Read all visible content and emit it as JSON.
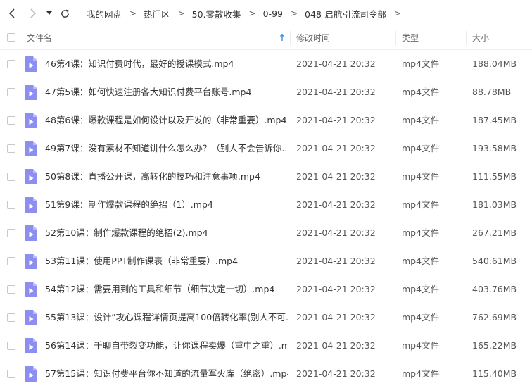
{
  "nav": {
    "breadcrumbs": [
      "我的网盘",
      "热门区",
      "50.零散收集",
      "0-99",
      "048-启航引流司令部"
    ],
    "separator": ">"
  },
  "columns": {
    "name": "文件名",
    "modified": "修改时间",
    "type": "类型",
    "size": "大小"
  },
  "colors": {
    "icon": "#8c8ff0",
    "checkbox_border": "#c8c8c8"
  },
  "files": [
    {
      "name": "46第4课：知识付费时代，最好的授课模式.mp4",
      "modified": "2021-04-21 20:32",
      "type": "mp4文件",
      "size": "188.04MB"
    },
    {
      "name": "47第5课：如何快速注册各大知识付费平台账号.mp4",
      "modified": "2021-04-21 20:32",
      "type": "mp4文件",
      "size": "88.78MB"
    },
    {
      "name": "48第6课：爆款课程是如何设计以及开发的（非常重要）.mp4",
      "modified": "2021-04-21 20:32",
      "type": "mp4文件",
      "size": "187.45MB"
    },
    {
      "name": "49第7课：没有素材不知道讲什么怎么办？（别人不会告诉你...",
      "modified": "2021-04-21 20:32",
      "type": "mp4文件",
      "size": "193.58MB"
    },
    {
      "name": "50第8课：直播公开课，高转化的技巧和注意事项.mp4",
      "modified": "2021-04-21 20:32",
      "type": "mp4文件",
      "size": "111.55MB"
    },
    {
      "name": "51第9课：制作爆款课程的绝招（1）.mp4",
      "modified": "2021-04-21 20:32",
      "type": "mp4文件",
      "size": "181.03MB"
    },
    {
      "name": "52第10课：制作爆款课程的绝招(2).mp4",
      "modified": "2021-04-21 20:32",
      "type": "mp4文件",
      "size": "267.21MB"
    },
    {
      "name": "53第11课：使用PPT制作课表（非常重要）.mp4",
      "modified": "2021-04-21 20:32",
      "type": "mp4文件",
      "size": "540.61MB"
    },
    {
      "name": "54第12课：需要用到的工具和细节（细节决定一切）.mp4",
      "modified": "2021-04-21 20:32",
      "type": "mp4文件",
      "size": "403.76MB"
    },
    {
      "name": "55第13课：设计”攻心课程详情页提高100倍转化率(别人不可...",
      "modified": "2021-04-21 20:32",
      "type": "mp4文件",
      "size": "762.69MB"
    },
    {
      "name": "56第14课：千聊自带裂变功能，让你课程卖爆（重中之重）.m...",
      "modified": "2021-04-21 20:32",
      "type": "mp4文件",
      "size": "165.22MB"
    },
    {
      "name": "57第15课：知识付费平台你不知道的流量军火库（绝密）.mp4",
      "modified": "2021-04-21 20:32",
      "type": "mp4文件",
      "size": "115.40MB"
    }
  ]
}
